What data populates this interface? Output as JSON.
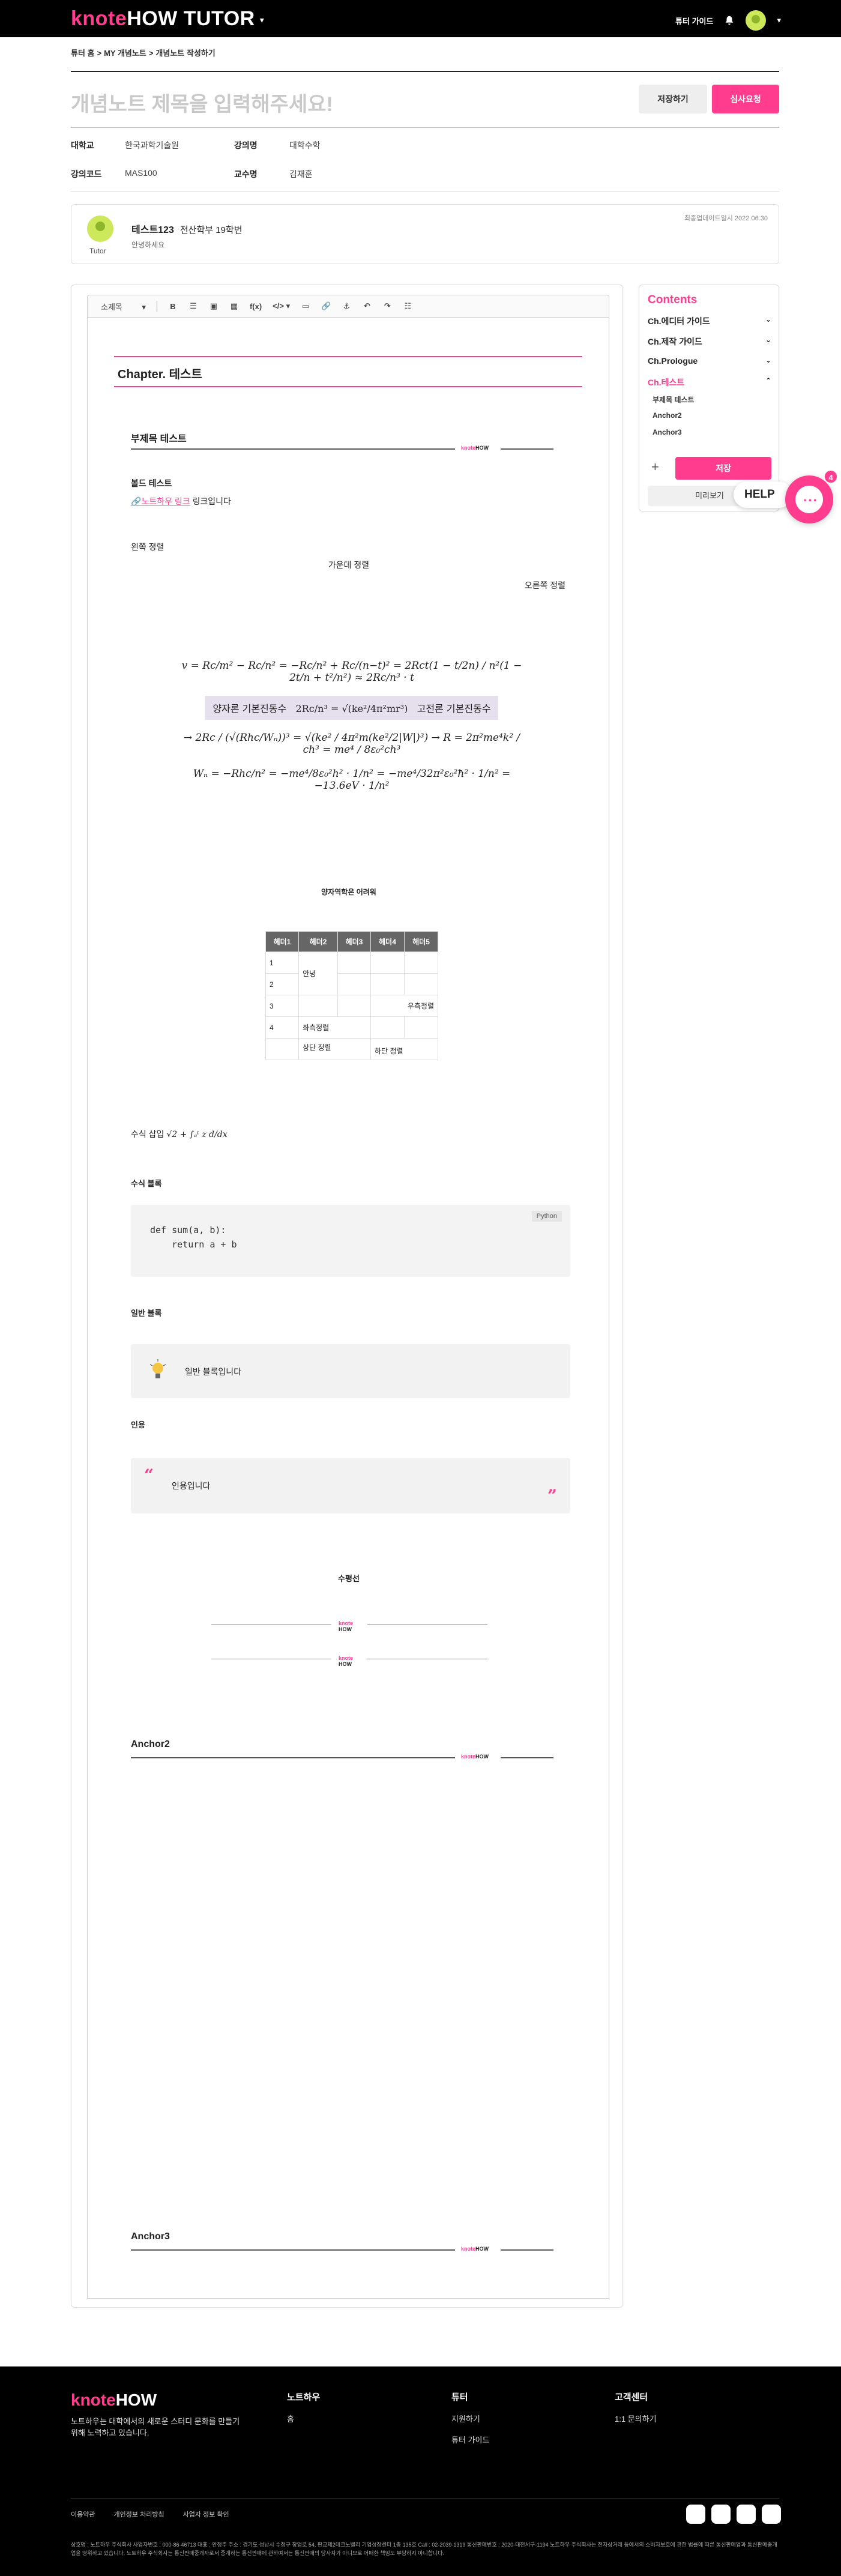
{
  "header": {
    "logo_main": "knote",
    "logo_rest": "HOW TUTOR",
    "tutor_guide": "튜터 가이드"
  },
  "breadcrumb": [
    "튜터 홈",
    ">",
    "MY 개념노트",
    ">",
    "개념노트 작성하기"
  ],
  "doc": {
    "title_placeholder": "개념노트 제목을 입력해주세요!",
    "save_label": "저장하기",
    "review_label": "심사요청"
  },
  "meta": {
    "school_k": "대학교",
    "school_v": "한국과학기술원",
    "lecture_k": "강의명",
    "lecture_v": "대학수학",
    "code_k": "강의코드",
    "code_v": "MAS100",
    "prof_k": "교수명",
    "prof_v": "김재훈"
  },
  "tutor": {
    "tag": "Tutor",
    "name": "테스트123",
    "dept": "전산학부 19학번",
    "greet": "안녕하세요",
    "date": "최종업데이트일시 2022.06.30"
  },
  "toolbar": {
    "style": "소제목",
    "bold": "B",
    "fx": "f(x)",
    "code": "</>"
  },
  "content": {
    "chapter": "Chapter. 테스트",
    "sub1": "부제목 테스트",
    "bold_test": "볼드 테스트",
    "link_text": "노트하우 링크",
    "link_suffix": " 링크입니다",
    "align_left": "왼쪽 정렬",
    "align_center": "가운데 정렬",
    "align_right": "오른쪽 정렬",
    "eq_box_left": "양자론 기본진동수",
    "eq_box_right": "고전론 기본진동수",
    "eq_caption": "양자역학은 어려워",
    "table": {
      "headers": [
        "헤더1",
        "헤더2",
        "헤더3",
        "헤더4",
        "헤더5"
      ],
      "r1": "1",
      "r2": "2",
      "r3": "3",
      "r4": "4",
      "annyeong": "안녕",
      "right_align": "우측정렬",
      "left_align": "좌측정렬",
      "top_align": "상단 정렬",
      "bottom_align": "하단 정렬"
    },
    "formula_label": "수식 삽입",
    "code_label": "수식 블록",
    "code_lang": "Python",
    "code_text": "def sum(a, b):\n    return a + b",
    "callout_label": "일반 블록",
    "callout_text": "일반 블록입니다",
    "quote_label": "인용",
    "quote_text": "인용입니다",
    "hr_label": "수평선",
    "anchor2": "Anchor2",
    "anchor3": "Anchor3"
  },
  "sidebar": {
    "title": "Contents",
    "items": [
      {
        "label": "Ch.에디터 가이드"
      },
      {
        "label": "Ch.제작 가이드"
      },
      {
        "label": "Ch.Prologue"
      },
      {
        "label": "Ch.테스트"
      }
    ],
    "subs": [
      "부제목 테스트",
      "Anchor2",
      "Anchor3"
    ],
    "save": "저장",
    "preview": "미리보기"
  },
  "help": {
    "label": "HELP",
    "badge": "4"
  },
  "footer": {
    "desc": "노트하우는 대학에서의 새로운 스터디 문화를 만들기 위해 노력하고 있습니다.",
    "col1_h": "노트하우",
    "col1_i1": "홈",
    "col2_h": "튜터",
    "col2_i1": "지원하기",
    "col2_i2": "튜터 가이드",
    "col3_h": "고객센터",
    "col3_i1": "1:1 문의하기",
    "links": [
      "이용약관",
      "개인정보 처리방침",
      "사업자 정보 확인"
    ],
    "legal": "상호명 : 노트하우 주식회사 사업자번호 : 000-86-46713 대표 : 안정주 주소 : 경기도 성남시 수정구 창업로 54, 판교제2테크노밸리 기업성장센터 1층 135호 Call : 02-2039-1319 통신판매번호 : 2020-대전서구-1194 노트하우 주식회사는 전자상거래 등에서의 소비자보호에 관한 법률에 따른 통신판매업과 통신판매중개업을 영위하고 있습니다. 노트하우 주식회사는 통신판매중개자로서 중개하는 통신판매에 관하여서는 통신판매의 당사자가 아니므로 어떠한 책임도 부담하지 아니합니다.",
    "colors": {
      "accent": "#ff3c8e"
    }
  }
}
